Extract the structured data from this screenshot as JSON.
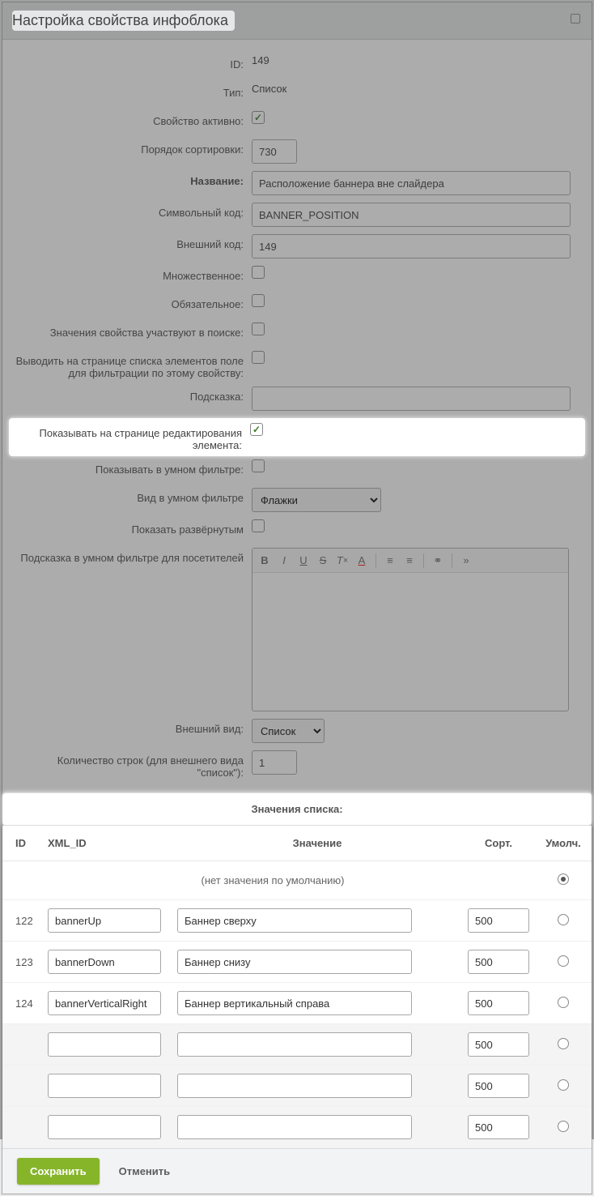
{
  "dialog": {
    "title": "Настройка свойства инфоблока"
  },
  "labels": {
    "id": "ID:",
    "type": "Тип:",
    "active": "Свойство активно:",
    "sort": "Порядок сортировки:",
    "name": "Название:",
    "code": "Символьный код:",
    "xml_id": "Внешний код:",
    "multiple": "Множественное:",
    "required": "Обязательное:",
    "searchable": "Значения свойства участвуют в поиске:",
    "filterable": "Выводить на странице списка элементов поле для фильтрации по этому свойству:",
    "hint": "Подсказка:",
    "show_on_edit": "Показывать на странице редактирования элемента:",
    "smart_filter": "Показывать в умном фильтре:",
    "smart_filter_view": "Вид в умном фильтре",
    "show_expanded": "Показать развёрнутым",
    "smart_filter_hint": "Подсказка в умном фильтре для посетителей",
    "external_view": "Внешний вид:",
    "row_count": "Количество строк (для внешнего вида \"список\"):"
  },
  "values": {
    "id": "149",
    "type": "Список",
    "sort": "730",
    "name": "Расположение баннера вне слайдера",
    "code": "BANNER_POSITION",
    "xml_id": "149",
    "hint": "",
    "smart_filter_view": "Флажки",
    "external_view": "Список",
    "row_count": "1"
  },
  "list_table": {
    "title": "Значения списка:",
    "headers": {
      "id": "ID",
      "xml_id": "XML_ID",
      "value": "Значение",
      "sort": "Сорт.",
      "default": "Умолч."
    },
    "no_default": "(нет значения по умолчанию)",
    "rows": [
      {
        "id": "122",
        "xml_id": "bannerUp",
        "value": "Баннер сверху",
        "sort": "500"
      },
      {
        "id": "123",
        "xml_id": "bannerDown",
        "value": "Баннер снизу",
        "sort": "500"
      },
      {
        "id": "124",
        "xml_id": "bannerVerticalRight",
        "value": "Баннер вертикальный справа",
        "sort": "500"
      },
      {
        "id": "",
        "xml_id": "",
        "value": "",
        "sort": "500"
      },
      {
        "id": "",
        "xml_id": "",
        "value": "",
        "sort": "500"
      },
      {
        "id": "",
        "xml_id": "",
        "value": "",
        "sort": "500"
      }
    ]
  },
  "buttons": {
    "save": "Сохранить",
    "cancel": "Отменить"
  }
}
